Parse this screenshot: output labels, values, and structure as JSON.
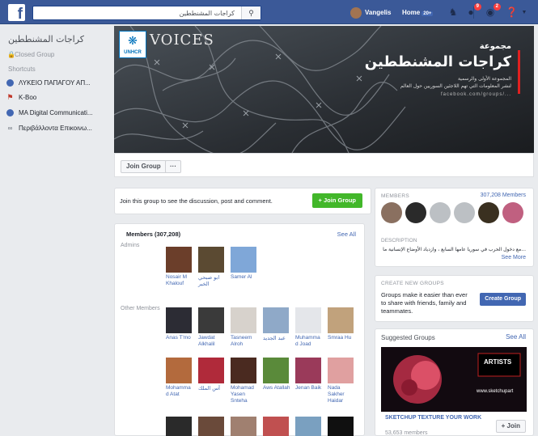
{
  "topbar": {
    "search_placeholder": "كراجات المشنططين",
    "user_name": "Vangelis",
    "home_label": "Home",
    "home_count": "20+",
    "friend_badge": "",
    "messages_badge": "9",
    "notifications_badge": "2"
  },
  "sidebar": {
    "group_name": "كراجات المشنططين",
    "privacy": "Closed Group",
    "shortcuts_label": "Shortcuts",
    "items": [
      {
        "label": "ΛΥΚΕΙΟ ΠΑΠΑΓΟΥ ΑΠ...",
        "icon": "group-icon"
      },
      {
        "label": "K-Boo",
        "icon": "page-icon"
      },
      {
        "label": "MA Digital Communicati...",
        "icon": "group-icon"
      },
      {
        "label": "Περιβάλλοντα Επικοινω...",
        "icon": "link-icon"
      }
    ]
  },
  "cover": {
    "logo_text": "UNHCR",
    "voices": "VOICES",
    "title_line1": "مجموعة",
    "title_line2": "كراجات المشنططين",
    "subtitle1": "المجموعة الأولى والرسمية",
    "subtitle2": "لنشر المعلومات التي تهم اللاجئين السوريين حول العالم",
    "url": "facebook.com/groups/..."
  },
  "actions": {
    "join_label": "Join Group",
    "more_label": "···"
  },
  "join_card": {
    "text": "Join this group to see the discussion, post and comment.",
    "button": "+ Join Group"
  },
  "members_card": {
    "title": "Members (307,208)",
    "see_all": "See All",
    "admins_label": "Admins",
    "other_label": "Other Members",
    "admins": [
      {
        "name": "Nosair M Khalouf"
      },
      {
        "name": "ابو صبحي الخبر"
      },
      {
        "name": "Samer Al"
      }
    ],
    "row1": [
      {
        "name": "Anas T'mo"
      },
      {
        "name": "Jawdat Alkhalil"
      },
      {
        "name": "Tasneem Alroh"
      },
      {
        "name": "عبد الجديد"
      },
      {
        "name": "Muhamma d Joad"
      },
      {
        "name": "Smraa Hu"
      }
    ],
    "row2": [
      {
        "name": "Mohamma d Atat"
      },
      {
        "name": "آس الملك"
      },
      {
        "name": "Mohamad Yasen Snteha"
      },
      {
        "name": "Aws Atallah"
      },
      {
        "name": "Jenan Baik"
      },
      {
        "name": "Nada Sakher Haidar"
      }
    ]
  },
  "members_side": {
    "title": "MEMBERS",
    "count": "307,208 Members",
    "description_label": "DESCRIPTION",
    "description": "مع دخول الحرب في سوريا عامها السابع ، وازدياد الأوضاع الإنسانية ما...",
    "see_more": "See More"
  },
  "create_groups": {
    "title": "CREATE NEW GROUPS",
    "text": "Groups make it easier than ever to share with friends, family and teammates.",
    "button": "Create Group"
  },
  "suggested": {
    "title": "Suggested Groups",
    "see_all": "See All",
    "image_text1": "ARTISTS",
    "image_text2": "www.sketchupart",
    "group_name": "SKETCHUP TEXTURE YOUR WORK",
    "members": "53,653 members",
    "join": "+ Join"
  }
}
